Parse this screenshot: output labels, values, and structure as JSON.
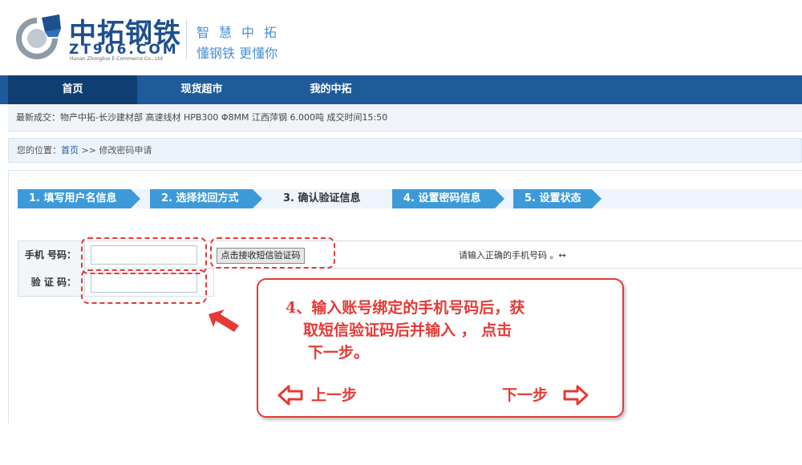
{
  "header": {
    "logo_cn": "中拓钢铁",
    "logo_en": "ZT906.COM",
    "logo_sub": "Hunan Zhongtuo E-Commerce Co., Ltd",
    "slogan_line1": "智慧中拓",
    "slogan_line2": "懂钢铁 更懂你"
  },
  "nav": {
    "items": [
      {
        "label": "首页",
        "active": true
      },
      {
        "label": "现货超市",
        "active": false
      },
      {
        "label": "我的中拓",
        "active": false
      }
    ]
  },
  "ticker": {
    "text": "最新成交：物产中拓-长沙建材部 高速线材 HPB300 Φ8MM 江西萍钢 6.000吨 成交时间15:50"
  },
  "breadcrumb": {
    "prefix": "您的位置：",
    "home": "首页",
    "separator": " >> ",
    "current": "修改密码申请"
  },
  "steps": [
    {
      "label": "1. 填写用户名信息",
      "current": false
    },
    {
      "label": "2. 选择找回方式",
      "current": false
    },
    {
      "label": "3. 确认验证信息",
      "current": true
    },
    {
      "label": "4. 设置密码信息",
      "current": false
    },
    {
      "label": "5. 设置状态",
      "current": false
    }
  ],
  "form": {
    "phone_label": "手机 号码：",
    "phone_value": "",
    "sms_button_label": "点击接收短信验证码",
    "phone_hint": "请输入正确的手机号码 。↔",
    "code_label": "验 证 码：",
    "code_value": ""
  },
  "callout": {
    "line1": "4、输入账号绑定的手机号码后，获",
    "line2": "取短信验证码后并输入 ， 点击",
    "line3": "下一步。",
    "prev_label": "上一步",
    "next_label": "下一步"
  },
  "colors": {
    "nav_bg": "#1f5a9a",
    "nav_active_bg": "#0f3f72",
    "step_bg": "#3d9ad9",
    "annotation_red": "#e53935",
    "brand_blue": "#1f4f8f"
  }
}
